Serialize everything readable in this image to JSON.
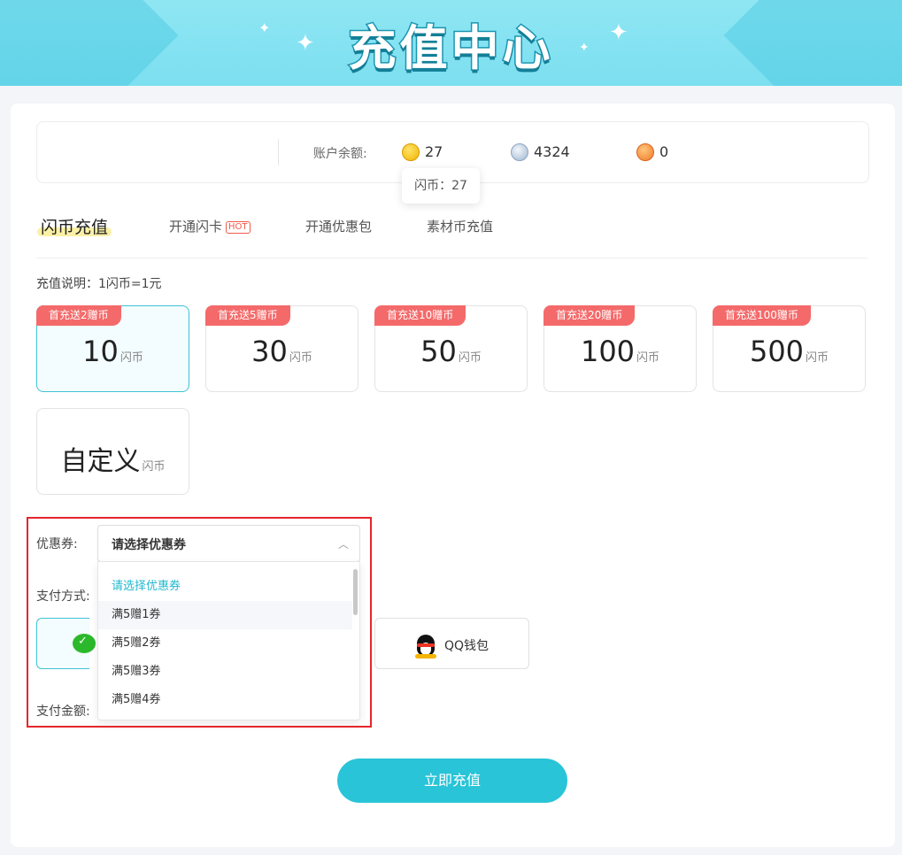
{
  "banner": {
    "title": "充值中心"
  },
  "balance": {
    "label": "账户余额:",
    "flash_coins": "27",
    "gift_coins": "4324",
    "material_coins": "0",
    "tooltip": "闪币：27"
  },
  "tabs": [
    {
      "label": "闪币充值",
      "active": true
    },
    {
      "label": "开通闪卡",
      "badge": "HOT"
    },
    {
      "label": "开通优惠包"
    },
    {
      "label": "素材币充值"
    }
  ],
  "description": "充值说明：1闪币=1元",
  "unit": "闪币",
  "amounts": [
    {
      "badge": "首充送2赠币",
      "value": "10",
      "selected": true
    },
    {
      "badge": "首充送5赠币",
      "value": "30"
    },
    {
      "badge": "首充送10赠币",
      "value": "50"
    },
    {
      "badge": "首充送20赠币",
      "value": "100"
    },
    {
      "badge": "首充送100赠币",
      "value": "500"
    }
  ],
  "custom_amount": "自定义",
  "coupon": {
    "label": "优惠券:",
    "selected": "请选择优惠券",
    "options": [
      "请选择优惠券",
      "满5赠1券",
      "满5赠2券",
      "满5赠3券",
      "满5赠4券"
    ]
  },
  "payment": {
    "label": "支付方式:",
    "methods": [
      "微信支付",
      "QQ钱包"
    ],
    "qq_label": "QQ钱包"
  },
  "pay_amount_label": "支付金额:",
  "submit_label": "立即充值",
  "colors": {
    "accent": "#29c4d8",
    "badge": "#f46a6a",
    "highlight": "#e5262b"
  }
}
